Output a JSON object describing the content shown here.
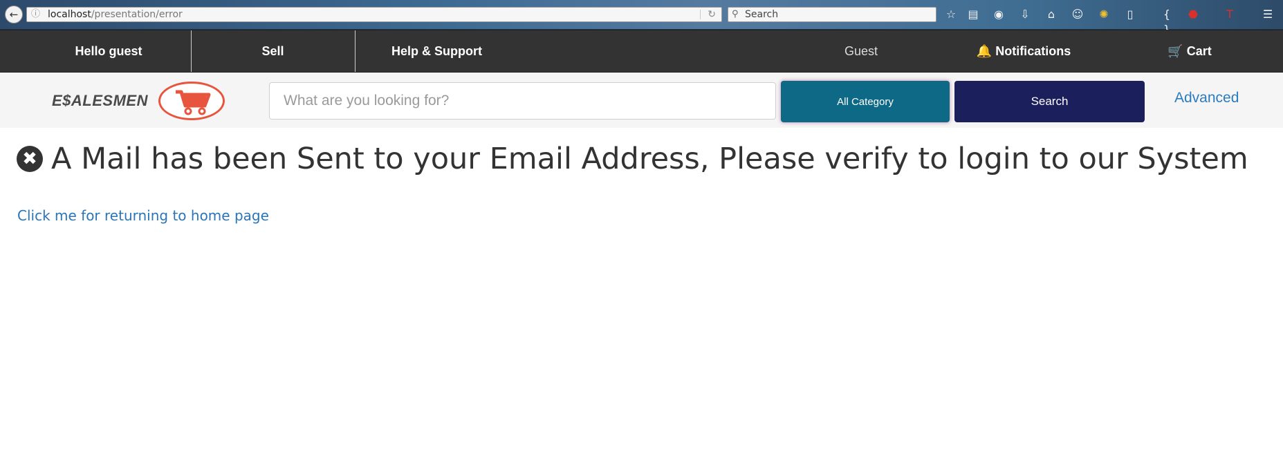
{
  "browser": {
    "url_host": "localhost",
    "url_path": "/presentation/error",
    "search_placeholder": "Search"
  },
  "topnav": {
    "hello": "Hello guest",
    "sell": "Sell",
    "help": "Help & Support",
    "guest": "Guest",
    "notifications": "Notifications",
    "cart": "Cart"
  },
  "searchbar": {
    "brand": "E$ALESMEN",
    "placeholder": "What are you looking for?",
    "category": "All Category",
    "search_button": "Search",
    "advanced": "Advanced"
  },
  "main": {
    "message": "A Mail has been Sent to your Email Address, Please verify to login to our System",
    "home_link": "Click me for returning to home page"
  },
  "colors": {
    "nav_bg": "#333333",
    "category_bg": "#0d6985",
    "search_bg": "#1b1f5c",
    "link": "#2b7bbf",
    "logo_red": "#e8553f"
  }
}
